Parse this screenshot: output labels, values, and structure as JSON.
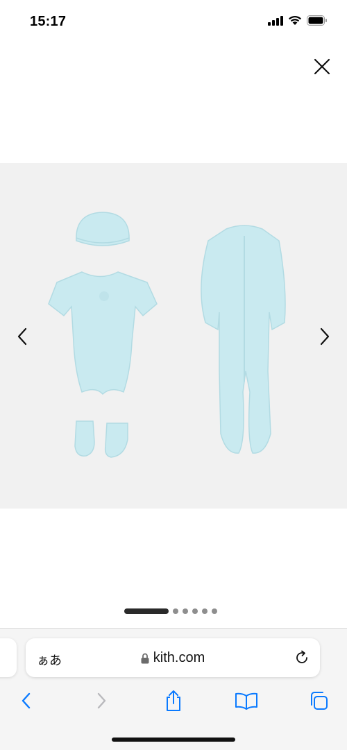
{
  "status_bar": {
    "time": "15:17",
    "icons": [
      "cellular-signal-icon",
      "wifi-icon",
      "battery-icon"
    ]
  },
  "viewer": {
    "close_icon": "close-icon",
    "prev_icon": "chevron-left-icon",
    "next_icon": "chevron-right-icon",
    "image_description_color": "#c8e9ef",
    "pagination": {
      "total": 6,
      "active_index": 0
    }
  },
  "browser": {
    "text_size_label": "ぁあ",
    "url": "kith.com",
    "lock_icon": "lock-icon",
    "reload_icon": "reload-icon",
    "toolbar": [
      "back-icon",
      "forward-icon",
      "share-icon",
      "bookmarks-icon",
      "tabs-icon"
    ],
    "accent_color": "#0a7aff"
  }
}
